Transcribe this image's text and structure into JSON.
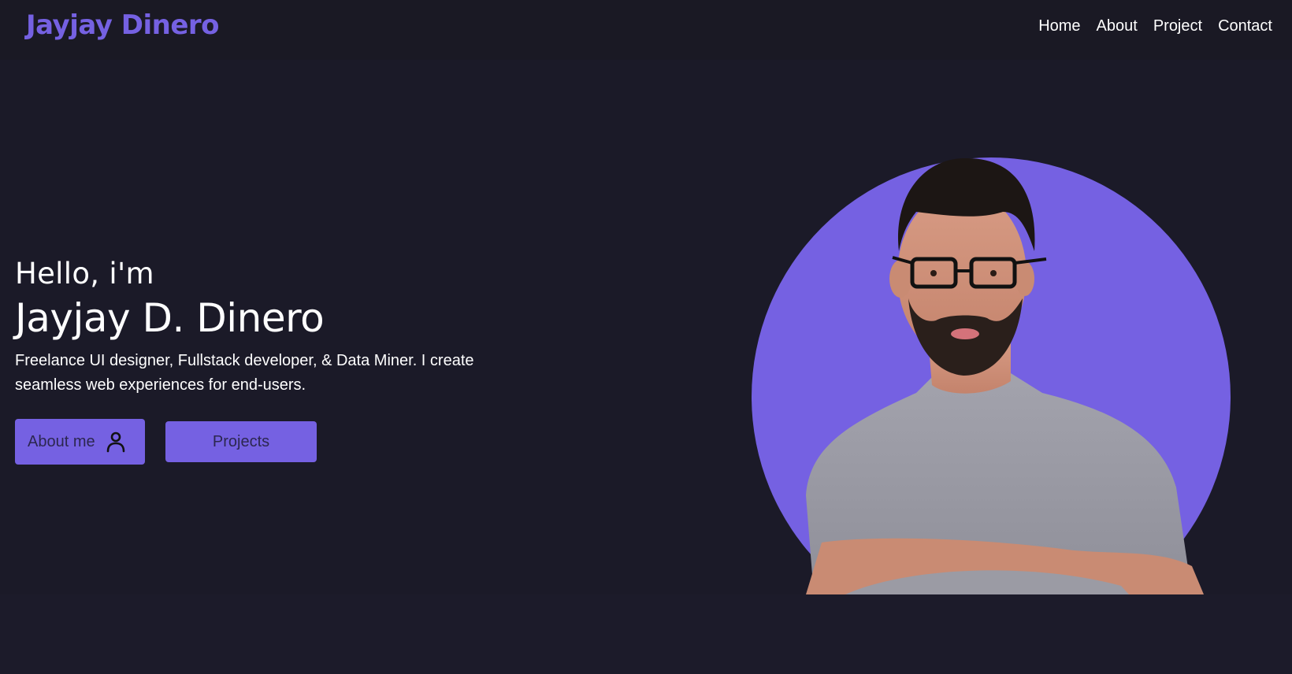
{
  "header": {
    "brand": "Jayjay Dinero",
    "nav": [
      "Home",
      "About",
      "Project",
      "Contact"
    ]
  },
  "hero": {
    "greeting": "Hello, i'm",
    "name": "Jayjay D. Dinero",
    "tagline": "Freelance UI designer, Fullstack developer, & Data Miner. I create seamless web experiences for end-users.",
    "about_button": "About me",
    "about_icon": "user-icon",
    "projects_button": "Projects"
  },
  "colors": {
    "background": "#1b1a28",
    "accent": "#7561e2",
    "text": "#ffffff"
  }
}
